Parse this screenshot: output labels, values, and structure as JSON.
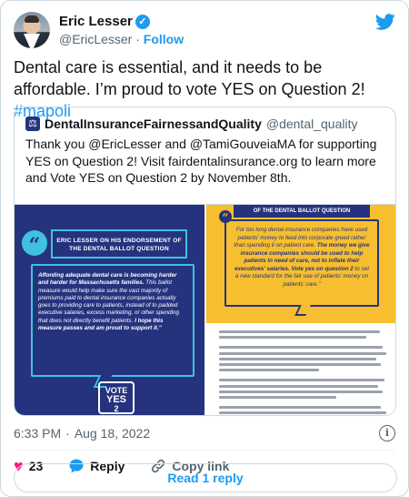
{
  "author": {
    "display_name": "Eric Lesser",
    "handle": "@EricLesser",
    "separator": "·",
    "follow_label": "Follow"
  },
  "tweet": {
    "text": "Dental care is essential, and it needs to be affordable. I’m proud to vote YES on Question 2! ",
    "hashtag": "#mapoli"
  },
  "quoted": {
    "display_name": "DentalInsuranceFairnessandQuality",
    "handle": "@dental_quality",
    "text": "Thank you @EricLesser and @TamiGouveiaMA for supporting YES on Question 2! Visit fairdentalinsurance.org to learn more and Vote YES on Question 2 by November 8th.",
    "left_image": {
      "title": "ERIC LESSER ON HIS ENDORSEMENT OF THE DENTAL BALLOT QUESTION",
      "body_bold_1": "Affording adequate dental care is becoming harder and harder for Massachusetts families.",
      "body_regular": " This ballot measure would help make sure the vast majority of premiums paid to dental insurance companies actually goes to providing care to patients, instead of to padded executive salaries, excess marketing, or other spending that does not directly benefit patients. ",
      "body_bold_2": "I hope this measure passes and am proud to support it.”",
      "logo_line1": "VOTE",
      "logo_line2": "YES",
      "logo_line3": "2"
    },
    "right_image": {
      "title": "OF THE DENTAL BALLOT QUESTION",
      "body_regular": "For too long dental insurance companies have used patients’ money to feed into corporate greed rather than spending it on patient care. ",
      "body_bold": "The money we give insurance companies should be used to help patients in need of care, not to inflate their executives’ salaries. Vote yes on question 2",
      "body_end": " to set a new standard for the fair use of patients’ money on patients’ care.”"
    }
  },
  "meta": {
    "time": "6:33 PM",
    "dot": "·",
    "date": "Aug 18, 2022"
  },
  "actions": {
    "like_count": "23",
    "reply_label": "Reply",
    "copy_label": "Copy link"
  },
  "read_replies_label": "Read 1 reply",
  "colors": {
    "accent": "#1d9bf0",
    "like": "#f91880",
    "navy": "#25337e",
    "cyan": "#3ec2e0",
    "yellow": "#f7bf2f"
  }
}
